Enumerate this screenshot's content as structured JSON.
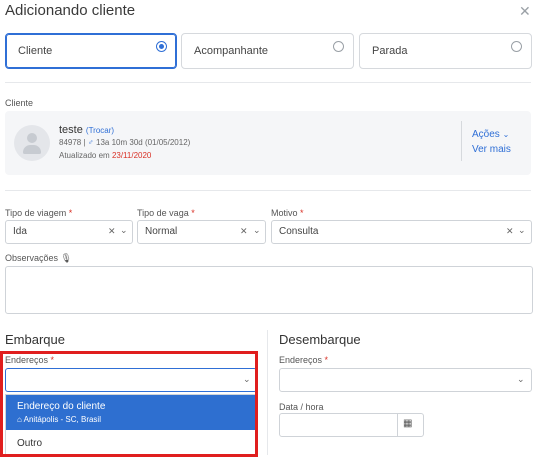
{
  "title": "Adicionando cliente",
  "close_glyph": "✕",
  "tipo_options": [
    {
      "label": "Cliente",
      "selected": true
    },
    {
      "label": "Acompanhante",
      "selected": false
    },
    {
      "label": "Parada",
      "selected": false
    }
  ],
  "cliente": {
    "section_label": "Cliente",
    "name": "teste",
    "trocar": "(Trocar)",
    "info_id": "84978 |",
    "gender_glyph": "♂",
    "info_age": "13a 10m 30d (01/05/2012)",
    "updated_prefix": "Atualizado em",
    "updated_date": "23/11/2020",
    "acoes": "Ações",
    "ver_mais": "Ver mais"
  },
  "fields": {
    "tipo_viagem": {
      "label": "Tipo de viagem",
      "value": "Ida"
    },
    "tipo_vaga": {
      "label": "Tipo de vaga",
      "value": "Normal"
    },
    "motivo": {
      "label": "Motivo",
      "value": "Consulta"
    },
    "observacoes": {
      "label": "Observações"
    }
  },
  "embarque": {
    "title": "Embarque",
    "enderecos_label": "Endereços",
    "options": [
      {
        "title": "Endereço do cliente",
        "subtitle": "Anitápolis - SC, Brasil"
      },
      {
        "title": "Outro"
      }
    ]
  },
  "desembarque": {
    "title": "Desembarque",
    "enderecos_label": "Endereços",
    "datahora_label": "Data / hora"
  },
  "colors": {
    "accent": "#2f6fd6",
    "required": "#d93025",
    "highlight": "#e01e1e",
    "dropdown_selected": "#2e6fd0"
  }
}
